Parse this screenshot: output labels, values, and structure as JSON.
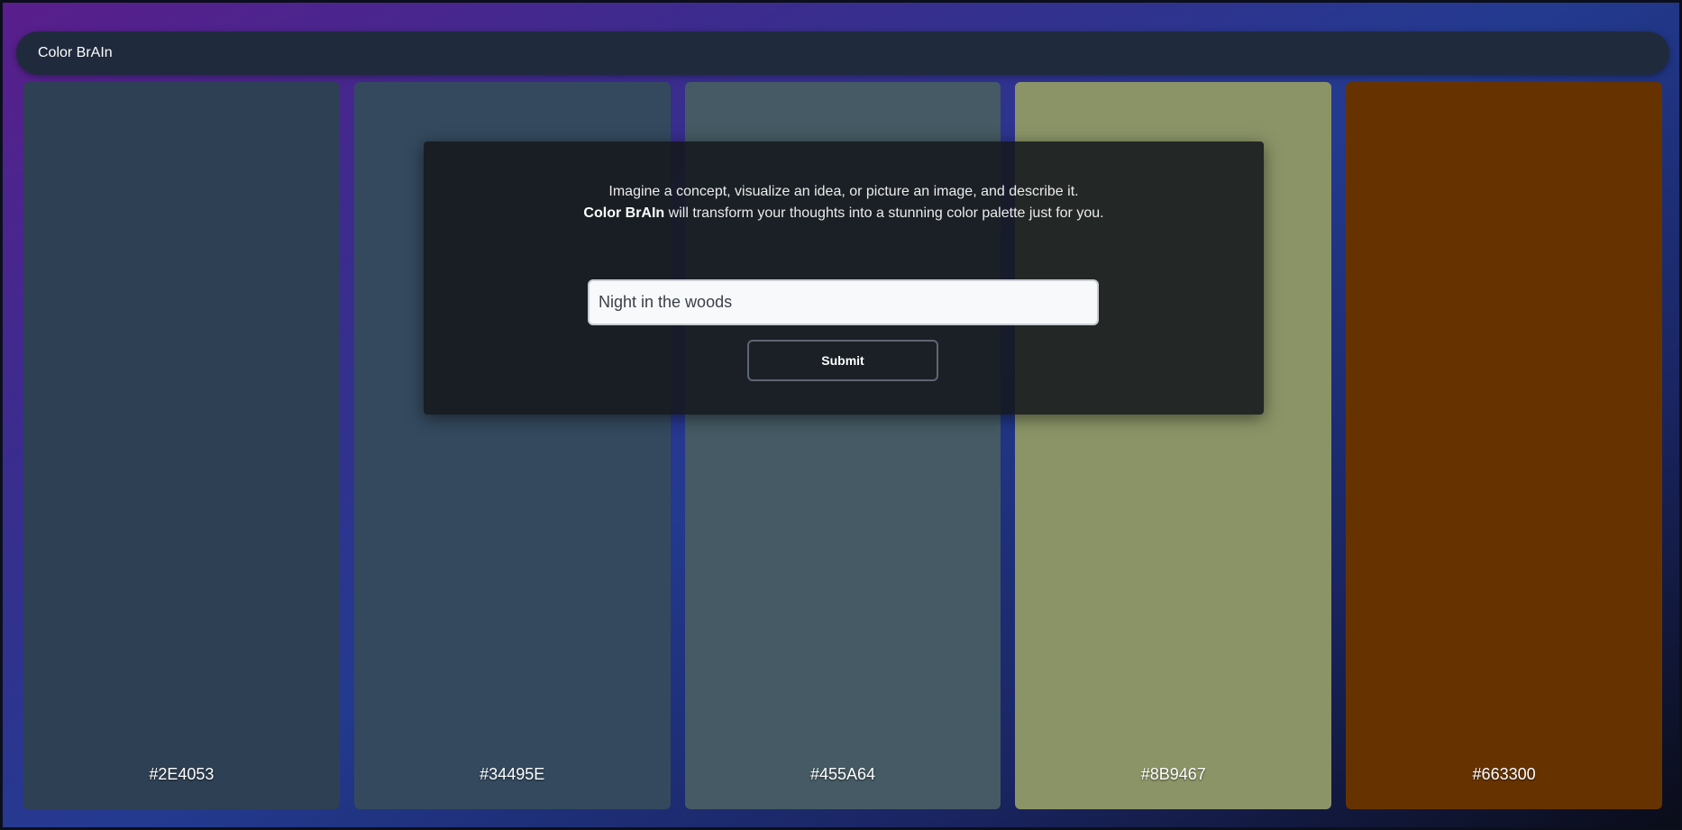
{
  "app": {
    "brand": "Color BrAIn"
  },
  "prompt": {
    "line1": "Imagine a concept, visualize an idea, or picture an image, and describe it.",
    "line2_brand": "Color BrAIn",
    "line2_rest": " will transform your thoughts into a stunning color palette just for you.",
    "input_value": "Night in the woods",
    "submit_label": "Submit"
  },
  "palette": [
    {
      "hex": "#2E4053",
      "color": "#2E4053"
    },
    {
      "hex": "#34495E",
      "color": "#34495E"
    },
    {
      "hex": "#455A64",
      "color": "#455A64"
    },
    {
      "hex": "#8B9467",
      "color": "#8B9467"
    },
    {
      "hex": "#663300",
      "color": "#663300"
    }
  ]
}
